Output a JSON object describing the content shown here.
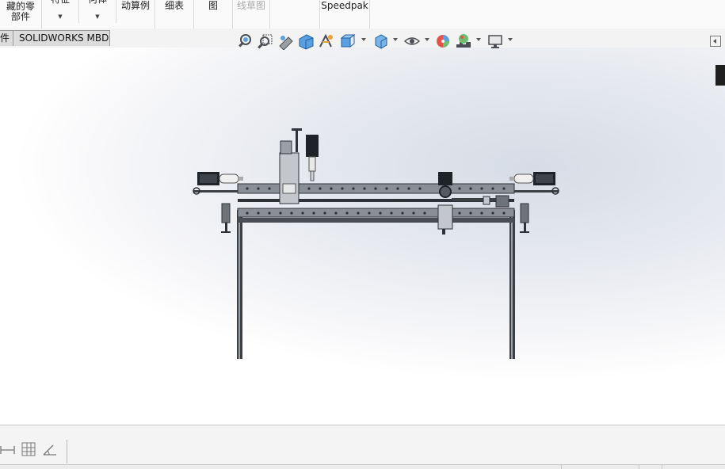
{
  "ribbon": {
    "groups": [
      {
        "line1": "藏的零",
        "line2": "部件",
        "caret": false
      },
      {
        "line1": "特征",
        "line2": "",
        "caret": true
      },
      {
        "line1": "何体",
        "line2": "",
        "caret": true
      },
      {
        "line1": "动算例",
        "line2": "",
        "caret": false
      },
      {
        "line1": "细表",
        "line2": "",
        "caret": false
      },
      {
        "line1": "图",
        "line2": "",
        "caret": false
      },
      {
        "line1": "线草图",
        "line2": "",
        "caret": false,
        "disabled": true
      },
      {
        "line1": "",
        "line2": "",
        "caret": false
      },
      {
        "line1": "Speedpak",
        "line2": "",
        "caret": false
      }
    ]
  },
  "tabs": [
    "件",
    "SOLIDWORKS MBD"
  ],
  "heads_up_toolbar": {
    "icons": [
      "zoom-to-fit-icon",
      "zoom-to-area-icon",
      "previous-view-icon",
      "section-view-icon",
      "dynamic-annotation-view-icon",
      "view-orientation-icon",
      "display-style-icon",
      "hide-show-items-icon",
      "edit-appearance-icon",
      "apply-scene-icon",
      "view-settings-icon"
    ]
  },
  "bottom_panel": {
    "icons": [
      "dimension-icon",
      "grid-icon",
      "angle-icon"
    ]
  },
  "colors": {
    "accent": "#1e72c8",
    "frame": "#3c3f44",
    "rail": "#8a8f96"
  }
}
